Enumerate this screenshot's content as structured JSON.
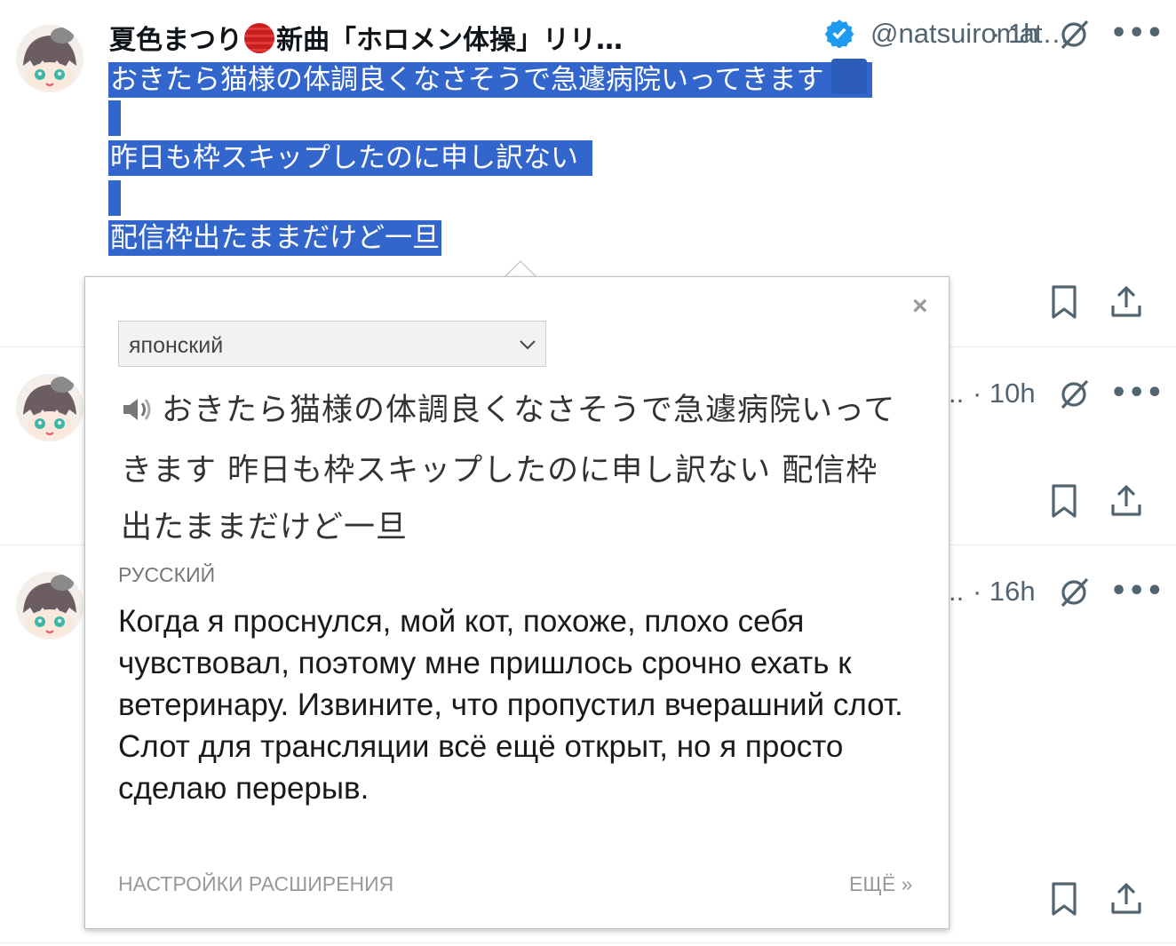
{
  "tweet1": {
    "name_part1": "夏色まつり",
    "name_part2": "新曲「ホロメン体操」リリ…",
    "handle": "@natsuiromat…",
    "time": "· 1h",
    "lines": [
      "おきたら猫様の体調良くなさそうで急遽病院いってきます",
      "",
      "昨日も枠スキップしたのに申し訳ない",
      "",
      "配信枠出たままだけど一旦"
    ]
  },
  "tweet2": {
    "time": "· 10h"
  },
  "tweet3": {
    "time": "· 16h"
  },
  "popup": {
    "source_language": "японский",
    "source_text": "おきたら猫様の体調良くなさそうで急遽病院いってきます 昨日も枠スキップしたのに申し訳ない 配信枠出たままだけど一旦",
    "target_language": "РУССКИЙ",
    "target_text": "Когда я проснулся, мой кот, похоже, плохо себя чувствовал, поэтому мне пришлось срочно ехать к ветеринару. Извините, что пропустил вчерашний слот. Слот для трансляции всё ещё открыт, но я просто сделаю перерыв.",
    "settings_label": "НАСТРОЙКИ РАСШИРЕНИЯ",
    "more_label": "ЕЩЁ »",
    "close_label": "×"
  },
  "colors": {
    "accent": "#1d9bf0",
    "selection": "#3366cc",
    "muted": "#536471"
  },
  "icons": [
    "verified-badge-icon",
    "grok-icon",
    "more-icon",
    "bookmark-icon",
    "share-icon",
    "speaker-icon",
    "chevron-down-icon",
    "close-icon"
  ]
}
